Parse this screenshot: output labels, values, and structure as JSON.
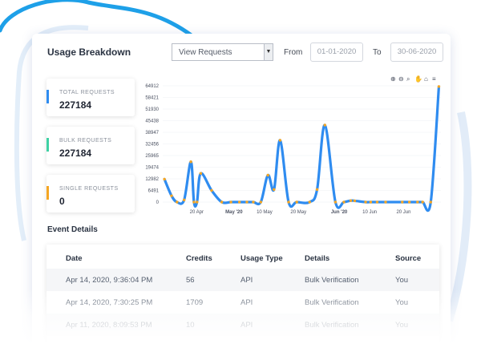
{
  "header": {
    "title": "Usage Breakdown",
    "select_value": "View Requests",
    "from_label": "From",
    "from_date": "01-01-2020",
    "to_label": "To",
    "to_date": "30-06-2020"
  },
  "stats": [
    {
      "label": "TOTAL REQUESTS",
      "value": "227184",
      "color": "#2f8cf0"
    },
    {
      "label": "BULK REQUESTS",
      "value": "227184",
      "color": "#3fd1a4"
    },
    {
      "label": "SINGLE REQUESTS",
      "value": "0",
      "color": "#f5a623"
    }
  ],
  "toolbar": {
    "zoom_in": "zoom-in-icon",
    "zoom_out": "zoom-out-icon",
    "zoom": "magnifier-icon",
    "pan": "hand-icon",
    "home": "home-icon",
    "menu": "menu-icon"
  },
  "chart_data": {
    "type": "line",
    "line_color": "#2f8cf0",
    "marker_color": "#f5a623",
    "y_ticks": [
      "0",
      "6491",
      "12982",
      "19474",
      "25965",
      "32456",
      "38947",
      "45438",
      "51930",
      "58421",
      "64912"
    ],
    "ylim": [
      0,
      64912
    ],
    "x_ticks": [
      "20 Apr",
      "May '20",
      "10 May",
      "20 May",
      "Jun '20",
      "10 Jun",
      "20 Jun"
    ],
    "x_tick_days": [
      20,
      31,
      40,
      50,
      62,
      71,
      81
    ],
    "x_ticks_bold": [
      false,
      true,
      false,
      false,
      true,
      false,
      false
    ],
    "xlim_days": [
      10,
      92
    ],
    "points": [
      {
        "day": 10.5,
        "value": 12800
      },
      {
        "day": 12.6,
        "value": 3500
      },
      {
        "day": 14.2,
        "value": 0
      },
      {
        "day": 16.3,
        "value": 1200
      },
      {
        "day": 18.3,
        "value": 22500
      },
      {
        "day": 19.2,
        "value": 0
      },
      {
        "day": 20.1,
        "value": 0
      },
      {
        "day": 21.2,
        "value": 16000
      },
      {
        "day": 24.4,
        "value": 6500
      },
      {
        "day": 27.4,
        "value": 0
      },
      {
        "day": 30.1,
        "value": 0
      },
      {
        "day": 32.6,
        "value": 0
      },
      {
        "day": 34.8,
        "value": 0
      },
      {
        "day": 36.7,
        "value": 0
      },
      {
        "day": 38.9,
        "value": 0
      },
      {
        "day": 41.0,
        "value": 15000
      },
      {
        "day": 42.8,
        "value": 7000
      },
      {
        "day": 44.6,
        "value": 34500
      },
      {
        "day": 47.1,
        "value": 0
      },
      {
        "day": 49.5,
        "value": 0
      },
      {
        "day": 53.3,
        "value": 0
      },
      {
        "day": 55.5,
        "value": 7000
      },
      {
        "day": 57.8,
        "value": 43000
      },
      {
        "day": 60.9,
        "value": 0
      },
      {
        "day": 63.4,
        "value": 0
      },
      {
        "day": 65.4,
        "value": 800
      },
      {
        "day": 66.6,
        "value": 700
      },
      {
        "day": 69.8,
        "value": 0
      },
      {
        "day": 71.3,
        "value": 0
      },
      {
        "day": 73.2,
        "value": 0
      },
      {
        "day": 75.7,
        "value": 0
      },
      {
        "day": 80.6,
        "value": 0
      },
      {
        "day": 82.7,
        "value": 0
      },
      {
        "day": 85.1,
        "value": 0
      },
      {
        "day": 86.6,
        "value": 0
      },
      {
        "day": 89.0,
        "value": 0
      },
      {
        "day": 91.4,
        "value": 64500
      }
    ]
  },
  "events": {
    "title": "Event Details",
    "columns": [
      "Date",
      "Credits",
      "Usage Type",
      "Details",
      "Source"
    ],
    "rows": [
      [
        "Apr 14, 2020, 9:36:04 PM",
        "56",
        "API",
        "Bulk Verification",
        "You"
      ],
      [
        "Apr 14, 2020, 7:30:25 PM",
        "1709",
        "API",
        "Bulk Verification",
        "You"
      ],
      [
        "Apr 11, 2020, 8:09:53 PM",
        "10",
        "API",
        "Bulk Verification",
        "You"
      ]
    ]
  }
}
